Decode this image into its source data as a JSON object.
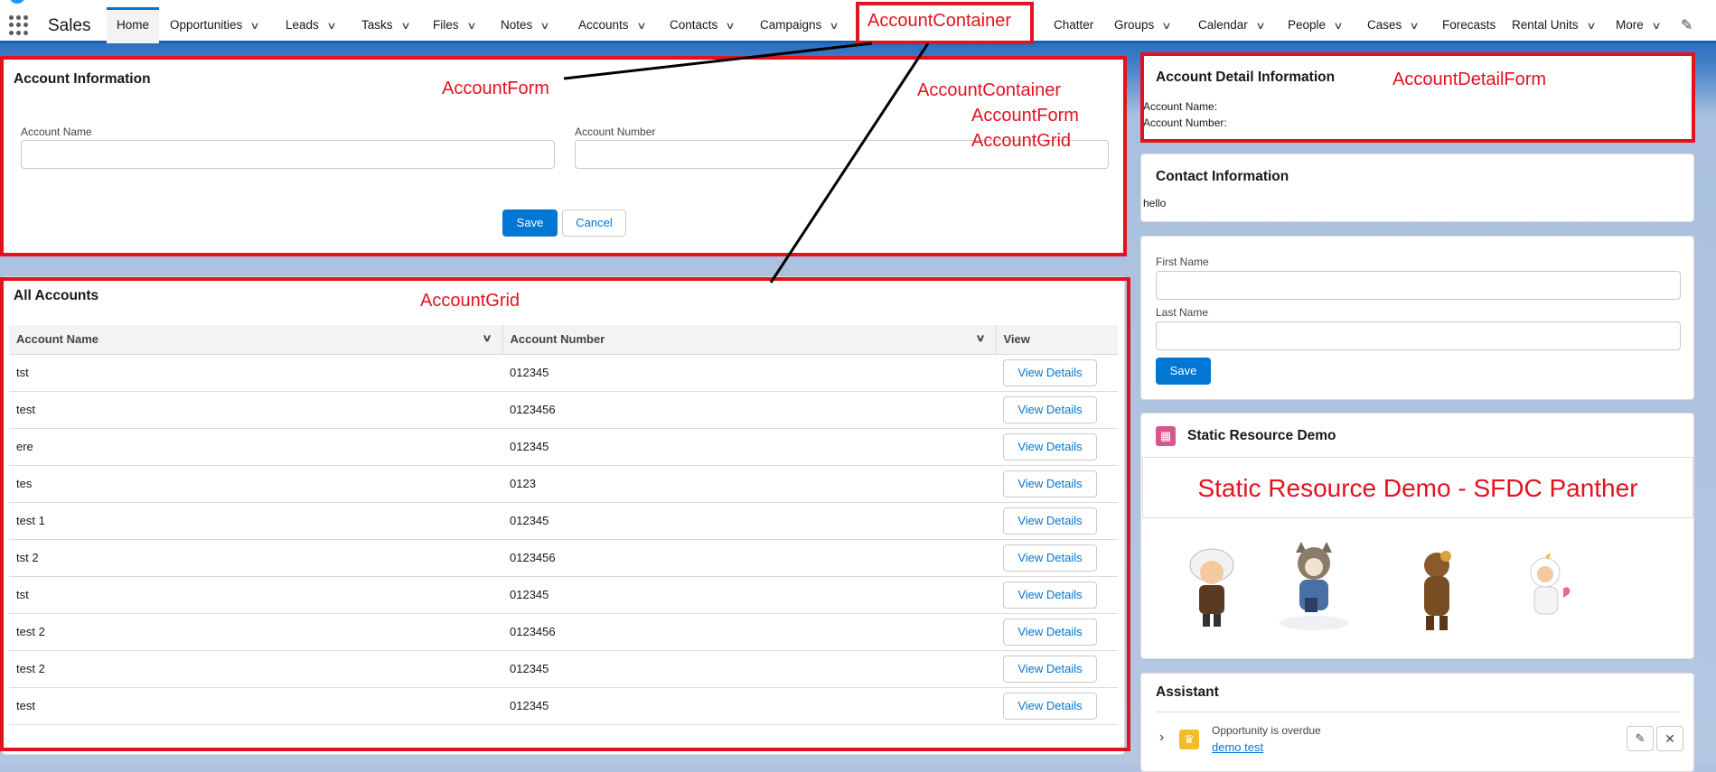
{
  "app": {
    "name": "Sales"
  },
  "nav": {
    "items": [
      {
        "label": "Home",
        "chevron": false,
        "active": true
      },
      {
        "label": "Opportunities",
        "chevron": true
      },
      {
        "label": "Leads",
        "chevron": true
      },
      {
        "label": "Tasks",
        "chevron": true
      },
      {
        "label": "Files",
        "chevron": true
      },
      {
        "label": "Notes",
        "chevron": true
      },
      {
        "label": "Accounts",
        "chevron": true
      },
      {
        "label": "Contacts",
        "chevron": true
      },
      {
        "label": "Campaigns",
        "chevron": true
      },
      {
        "label": "Chatter",
        "chevron": false
      },
      {
        "label": "Groups",
        "chevron": true
      },
      {
        "label": "Calendar",
        "chevron": true
      },
      {
        "label": "People",
        "chevron": true
      },
      {
        "label": "Cases",
        "chevron": true
      },
      {
        "label": "Forecasts",
        "chevron": false
      },
      {
        "label": "Rental Units",
        "chevron": true
      },
      {
        "label": "More",
        "chevron": true
      }
    ]
  },
  "annotations": {
    "account_container_top": "AccountContainer",
    "account_form": "AccountForm",
    "stack_line1": "AccountContainer",
    "stack_line2": "AccountForm",
    "stack_line3": "AccountGrid",
    "account_grid": "AccountGrid",
    "account_detail_form": "AccountDetailForm",
    "color": "#e3121f"
  },
  "account_form": {
    "title": "Account Information",
    "name_label": "Account Name",
    "number_label": "Account Number",
    "save_label": "Save",
    "cancel_label": "Cancel"
  },
  "account_grid": {
    "title": "All Accounts",
    "columns": [
      "Account Name",
      "Account Number",
      "View"
    ],
    "view_label": "View Details",
    "rows": [
      {
        "name": "tst",
        "number": "012345"
      },
      {
        "name": "test",
        "number": "0123456"
      },
      {
        "name": "ere",
        "number": "012345"
      },
      {
        "name": "tes",
        "number": "0123"
      },
      {
        "name": "test 1",
        "number": "012345"
      },
      {
        "name": "tst 2",
        "number": "0123456"
      },
      {
        "name": "tst",
        "number": "012345"
      },
      {
        "name": "test 2",
        "number": "0123456"
      },
      {
        "name": "test 2",
        "number": "012345"
      },
      {
        "name": "test",
        "number": "012345"
      }
    ]
  },
  "account_detail": {
    "title": "Account Detail Information",
    "name_label": "Account Name:",
    "number_label": "Account Number:"
  },
  "contact_info": {
    "title": "Contact Information",
    "text": "hello"
  },
  "contact_form": {
    "first_name_label": "First Name",
    "last_name_label": "Last Name",
    "save_label": "Save"
  },
  "static_resource": {
    "title": "Static Resource Demo",
    "banner": "Static Resource Demo - SFDC Panther"
  },
  "assistant": {
    "title": "Assistant",
    "item_text": "Opportunity is overdue",
    "item_link": "demo test"
  },
  "colors": {
    "brand": "#0176d3",
    "annotation": "#e3121f",
    "nav_accent": "#1b5fb0"
  }
}
